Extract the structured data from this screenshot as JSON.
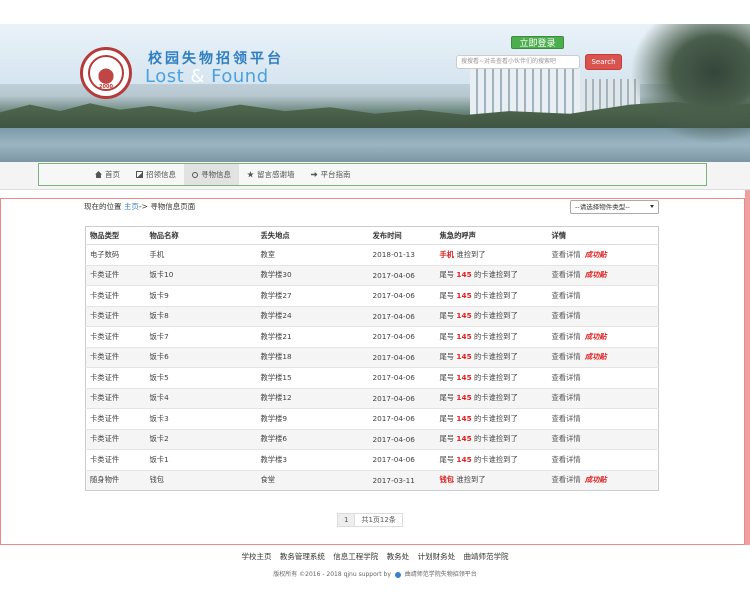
{
  "header": {
    "title_cn": "校园失物招领平台",
    "title_en_part1": "Lost",
    "title_en_amp": " & ",
    "title_en_part2": "Found",
    "logo_year": "2000",
    "login_label": "立即登录",
    "search_placeholder": "搜搜看~对击查看小伙伴们的搜索吧",
    "search_label": "Search"
  },
  "nav": {
    "items": [
      {
        "label": "首页",
        "icon": "home-icon"
      },
      {
        "label": "招领信息",
        "icon": "picture-icon"
      },
      {
        "label": "寻物信息",
        "icon": "search-icon"
      },
      {
        "label": "留言感谢墙",
        "icon": "star-icon"
      },
      {
        "label": "平台指南",
        "icon": "hand-right-icon"
      }
    ],
    "active_index": 2
  },
  "breadcrumb": {
    "prefix": "现在的位置",
    "home": "主页",
    "arrow": "->",
    "current": "寻物信息页面"
  },
  "type_select": {
    "value": "--请选择物件类型--"
  },
  "table": {
    "headers": [
      "物品类型",
      "物品名称",
      "丢失地点",
      "发布时间",
      "焦急的呼声",
      "详情"
    ],
    "rows": [
      {
        "type": "电子数码",
        "name": "手机",
        "place": "教室",
        "date": "2018-01-13",
        "cry_highlight": "手机",
        "cry_rest": "谁捡到了",
        "cry_mid": "",
        "cry_tail": "",
        "detail": "查看详情",
        "success": "成功贴"
      },
      {
        "type": "卡类证件",
        "name": "饭卡10",
        "place": "教学楼30",
        "date": "2017-04-06",
        "cry_highlight": "",
        "cry_rest": "尾号 ",
        "cry_mid": "145",
        "cry_tail": " 的卡谁捡到了",
        "detail": "查看详情",
        "success": "成功贴"
      },
      {
        "type": "卡类证件",
        "name": "饭卡9",
        "place": "教学楼27",
        "date": "2017-04-06",
        "cry_highlight": "",
        "cry_rest": "尾号 ",
        "cry_mid": "145",
        "cry_tail": " 的卡谁捡到了",
        "detail": "查看详情",
        "success": ""
      },
      {
        "type": "卡类证件",
        "name": "饭卡8",
        "place": "教学楼24",
        "date": "2017-04-06",
        "cry_highlight": "",
        "cry_rest": "尾号 ",
        "cry_mid": "145",
        "cry_tail": " 的卡谁捡到了",
        "detail": "查看详情",
        "success": ""
      },
      {
        "type": "卡类证件",
        "name": "饭卡7",
        "place": "教学楼21",
        "date": "2017-04-06",
        "cry_highlight": "",
        "cry_rest": "尾号 ",
        "cry_mid": "145",
        "cry_tail": " 的卡谁捡到了",
        "detail": "查看详情",
        "success": "成功贴"
      },
      {
        "type": "卡类证件",
        "name": "饭卡6",
        "place": "教学楼18",
        "date": "2017-04-06",
        "cry_highlight": "",
        "cry_rest": "尾号 ",
        "cry_mid": "145",
        "cry_tail": " 的卡谁捡到了",
        "detail": "查看详情",
        "success": "成功贴"
      },
      {
        "type": "卡类证件",
        "name": "饭卡5",
        "place": "教学楼15",
        "date": "2017-04-06",
        "cry_highlight": "",
        "cry_rest": "尾号 ",
        "cry_mid": "145",
        "cry_tail": " 的卡谁捡到了",
        "detail": "查看详情",
        "success": ""
      },
      {
        "type": "卡类证件",
        "name": "饭卡4",
        "place": "教学楼12",
        "date": "2017-04-06",
        "cry_highlight": "",
        "cry_rest": "尾号 ",
        "cry_mid": "145",
        "cry_tail": " 的卡谁捡到了",
        "detail": "查看详情",
        "success": ""
      },
      {
        "type": "卡类证件",
        "name": "饭卡3",
        "place": "教学楼9",
        "date": "2017-04-06",
        "cry_highlight": "",
        "cry_rest": "尾号 ",
        "cry_mid": "145",
        "cry_tail": " 的卡谁捡到了",
        "detail": "查看详情",
        "success": ""
      },
      {
        "type": "卡类证件",
        "name": "饭卡2",
        "place": "教学楼6",
        "date": "2017-04-06",
        "cry_highlight": "",
        "cry_rest": "尾号 ",
        "cry_mid": "145",
        "cry_tail": " 的卡谁捡到了",
        "detail": "查看详情",
        "success": ""
      },
      {
        "type": "卡类证件",
        "name": "饭卡1",
        "place": "教学楼3",
        "date": "2017-04-06",
        "cry_highlight": "",
        "cry_rest": "尾号 ",
        "cry_mid": "145",
        "cry_tail": " 的卡谁捡到了",
        "detail": "查看详情",
        "success": ""
      },
      {
        "type": "随身物件",
        "name": "钱包",
        "place": "食堂",
        "date": "2017-03-11",
        "cry_highlight": "钱包",
        "cry_rest": "谁捡到了",
        "cry_mid": "",
        "cry_tail": "",
        "detail": "查看详情",
        "success": "成功贴"
      }
    ]
  },
  "pager": {
    "page": "1",
    "info": "共1页12条"
  },
  "footer": {
    "links": [
      "学校主页",
      "教务管理系统",
      "信息工程学院",
      "教务处",
      "计划财务处",
      "曲靖师范学院"
    ],
    "copyright_a": "版权所有 ©2016 - 2018 qjnu support by",
    "copyright_b": "曲靖师范学院失物招领平台"
  },
  "colors": {
    "accent_green": "#4cae4c",
    "accent_red": "#d9534f",
    "link_blue": "#3a7fc4",
    "panel_border": "#e88a8a"
  }
}
